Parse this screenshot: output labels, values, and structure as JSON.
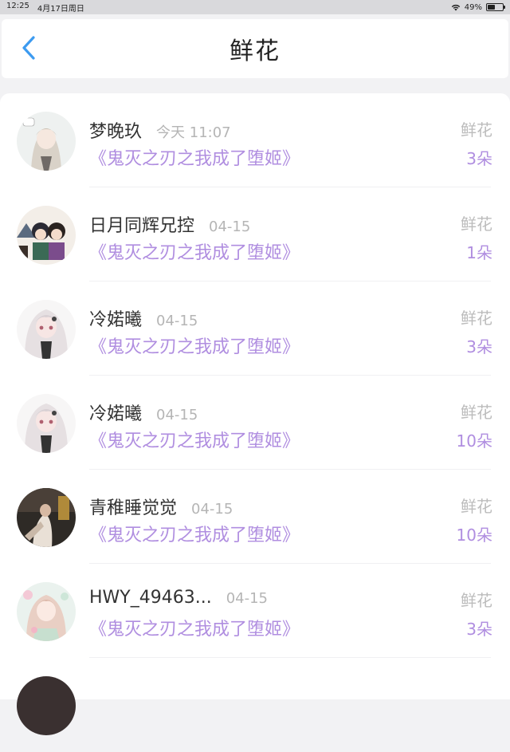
{
  "status": {
    "time": "12:25",
    "date": "4月17日周日",
    "battery": "49%",
    "battery_level": 0.49
  },
  "nav": {
    "title": "鲜花"
  },
  "items": [
    {
      "name": "梦晚玖",
      "time": "今天 11:07",
      "book": "《鬼灭之刃之我成了堕姬》",
      "gift": "鲜花",
      "count": "3朵"
    },
    {
      "name": "日月同辉兄控",
      "time": "04-15",
      "book": "《鬼灭之刃之我成了堕姬》",
      "gift": "鲜花",
      "count": "1朵"
    },
    {
      "name": "冷婼曦",
      "time": "04-15",
      "book": "《鬼灭之刃之我成了堕姬》",
      "gift": "鲜花",
      "count": "3朵"
    },
    {
      "name": "冷婼曦",
      "time": "04-15",
      "book": "《鬼灭之刃之我成了堕姬》",
      "gift": "鲜花",
      "count": "10朵"
    },
    {
      "name": "青稚睡觉觉",
      "time": "04-15",
      "book": "《鬼灭之刃之我成了堕姬》",
      "gift": "鲜花",
      "count": "10朵"
    },
    {
      "name": "HWY_49463...",
      "time": "04-15",
      "book": "《鬼灭之刃之我成了堕姬》",
      "gift": "鲜花",
      "count": "3朵"
    }
  ],
  "colors": {
    "accent": "#3d9bf0",
    "book_purple": "#b08ee0",
    "muted": "#b5b5b5"
  }
}
